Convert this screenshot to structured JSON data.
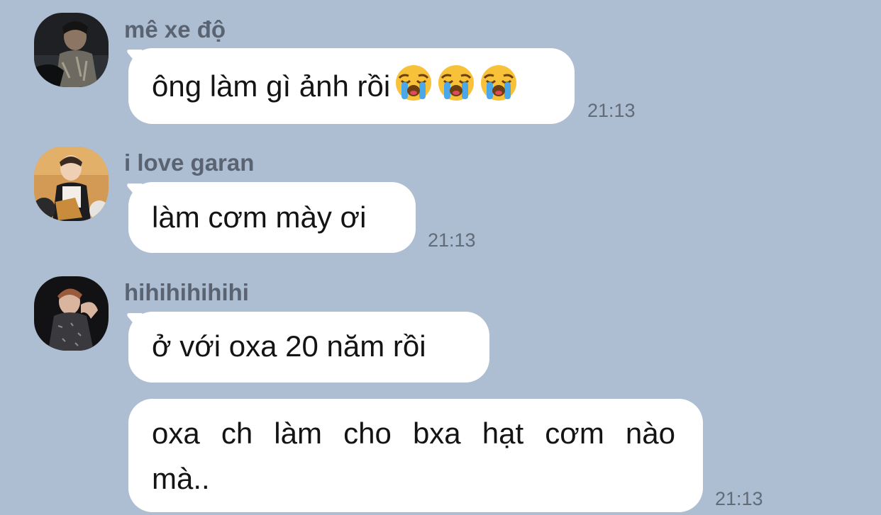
{
  "messages": [
    {
      "sender": "mê xe độ",
      "text": "ông làm gì ảnh rồi",
      "emojis": [
        "loudly-crying-face-emoji",
        "loudly-crying-face-emoji",
        "loudly-crying-face-emoji"
      ],
      "time": "21:13"
    },
    {
      "sender": "i love garan",
      "text": "làm cơm mày ơi",
      "time": "21:13"
    },
    {
      "sender": "hihihihihihi",
      "text": "ở với oxa 20 năm rồi",
      "time": ""
    },
    {
      "sender": "",
      "text": "oxa ch làm cho bxa hạt cơm nào mà..",
      "time": "21:13"
    }
  ],
  "colors": {
    "background": "#adbdd2",
    "bubble": "#ffffff",
    "sender_text": "#5a6372",
    "timestamp_text": "#626b78"
  }
}
